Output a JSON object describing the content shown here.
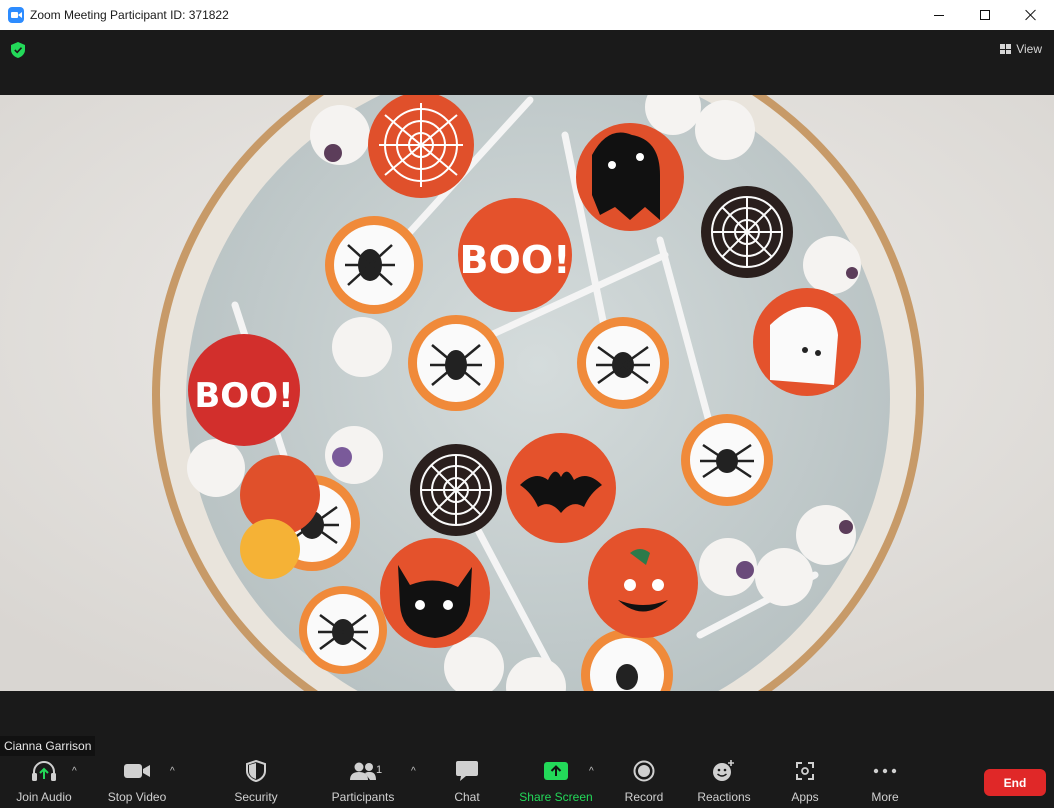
{
  "window": {
    "title": "Zoom Meeting Participant ID: 371822"
  },
  "topbar": {
    "view_label": "View"
  },
  "video": {
    "participant_name": "Cianna Garrison"
  },
  "toolbar": {
    "join_audio": "Join Audio",
    "stop_video": "Stop Video",
    "security": "Security",
    "participants": "Participants",
    "participants_count": "1",
    "chat": "Chat",
    "share_screen": "Share Screen",
    "record": "Record",
    "reactions": "Reactions",
    "apps": "Apps",
    "more": "More",
    "end": "End"
  },
  "colors": {
    "share_green": "#23d959",
    "end_red": "#e02828",
    "shield_green": "#23d959",
    "accent_blue": "#2d8cff"
  },
  "icons": [
    "zoom-app-icon",
    "shield-icon",
    "grid-icon",
    "headphones-icon",
    "video-camera-icon",
    "security-shield-icon",
    "participants-icon",
    "chat-icon",
    "share-screen-icon",
    "record-icon",
    "reactions-icon",
    "apps-icon",
    "more-icon"
  ]
}
